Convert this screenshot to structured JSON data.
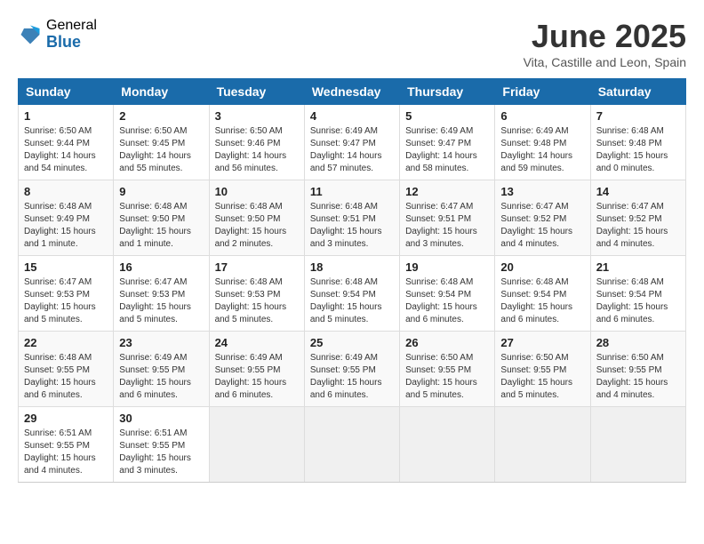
{
  "header": {
    "logo_general": "General",
    "logo_blue": "Blue",
    "month_title": "June 2025",
    "subtitle": "Vita, Castille and Leon, Spain"
  },
  "days_of_week": [
    "Sunday",
    "Monday",
    "Tuesday",
    "Wednesday",
    "Thursday",
    "Friday",
    "Saturday"
  ],
  "weeks": [
    [
      {
        "day": "1",
        "sunrise": "6:50 AM",
        "sunset": "9:44 PM",
        "daylight": "14 hours and 54 minutes."
      },
      {
        "day": "2",
        "sunrise": "6:50 AM",
        "sunset": "9:45 PM",
        "daylight": "14 hours and 55 minutes."
      },
      {
        "day": "3",
        "sunrise": "6:50 AM",
        "sunset": "9:46 PM",
        "daylight": "14 hours and 56 minutes."
      },
      {
        "day": "4",
        "sunrise": "6:49 AM",
        "sunset": "9:47 PM",
        "daylight": "14 hours and 57 minutes."
      },
      {
        "day": "5",
        "sunrise": "6:49 AM",
        "sunset": "9:47 PM",
        "daylight": "14 hours and 58 minutes."
      },
      {
        "day": "6",
        "sunrise": "6:49 AM",
        "sunset": "9:48 PM",
        "daylight": "14 hours and 59 minutes."
      },
      {
        "day": "7",
        "sunrise": "6:48 AM",
        "sunset": "9:48 PM",
        "daylight": "15 hours and 0 minutes."
      }
    ],
    [
      {
        "day": "8",
        "sunrise": "6:48 AM",
        "sunset": "9:49 PM",
        "daylight": "15 hours and 1 minute."
      },
      {
        "day": "9",
        "sunrise": "6:48 AM",
        "sunset": "9:50 PM",
        "daylight": "15 hours and 1 minute."
      },
      {
        "day": "10",
        "sunrise": "6:48 AM",
        "sunset": "9:50 PM",
        "daylight": "15 hours and 2 minutes."
      },
      {
        "day": "11",
        "sunrise": "6:48 AM",
        "sunset": "9:51 PM",
        "daylight": "15 hours and 3 minutes."
      },
      {
        "day": "12",
        "sunrise": "6:47 AM",
        "sunset": "9:51 PM",
        "daylight": "15 hours and 3 minutes."
      },
      {
        "day": "13",
        "sunrise": "6:47 AM",
        "sunset": "9:52 PM",
        "daylight": "15 hours and 4 minutes."
      },
      {
        "day": "14",
        "sunrise": "6:47 AM",
        "sunset": "9:52 PM",
        "daylight": "15 hours and 4 minutes."
      }
    ],
    [
      {
        "day": "15",
        "sunrise": "6:47 AM",
        "sunset": "9:53 PM",
        "daylight": "15 hours and 5 minutes."
      },
      {
        "day": "16",
        "sunrise": "6:47 AM",
        "sunset": "9:53 PM",
        "daylight": "15 hours and 5 minutes."
      },
      {
        "day": "17",
        "sunrise": "6:48 AM",
        "sunset": "9:53 PM",
        "daylight": "15 hours and 5 minutes."
      },
      {
        "day": "18",
        "sunrise": "6:48 AM",
        "sunset": "9:54 PM",
        "daylight": "15 hours and 5 minutes."
      },
      {
        "day": "19",
        "sunrise": "6:48 AM",
        "sunset": "9:54 PM",
        "daylight": "15 hours and 6 minutes."
      },
      {
        "day": "20",
        "sunrise": "6:48 AM",
        "sunset": "9:54 PM",
        "daylight": "15 hours and 6 minutes."
      },
      {
        "day": "21",
        "sunrise": "6:48 AM",
        "sunset": "9:54 PM",
        "daylight": "15 hours and 6 minutes."
      }
    ],
    [
      {
        "day": "22",
        "sunrise": "6:48 AM",
        "sunset": "9:55 PM",
        "daylight": "15 hours and 6 minutes."
      },
      {
        "day": "23",
        "sunrise": "6:49 AM",
        "sunset": "9:55 PM",
        "daylight": "15 hours and 6 minutes."
      },
      {
        "day": "24",
        "sunrise": "6:49 AM",
        "sunset": "9:55 PM",
        "daylight": "15 hours and 6 minutes."
      },
      {
        "day": "25",
        "sunrise": "6:49 AM",
        "sunset": "9:55 PM",
        "daylight": "15 hours and 6 minutes."
      },
      {
        "day": "26",
        "sunrise": "6:50 AM",
        "sunset": "9:55 PM",
        "daylight": "15 hours and 5 minutes."
      },
      {
        "day": "27",
        "sunrise": "6:50 AM",
        "sunset": "9:55 PM",
        "daylight": "15 hours and 5 minutes."
      },
      {
        "day": "28",
        "sunrise": "6:50 AM",
        "sunset": "9:55 PM",
        "daylight": "15 hours and 4 minutes."
      }
    ],
    [
      {
        "day": "29",
        "sunrise": "6:51 AM",
        "sunset": "9:55 PM",
        "daylight": "15 hours and 4 minutes."
      },
      {
        "day": "30",
        "sunrise": "6:51 AM",
        "sunset": "9:55 PM",
        "daylight": "15 hours and 3 minutes."
      },
      null,
      null,
      null,
      null,
      null
    ]
  ]
}
